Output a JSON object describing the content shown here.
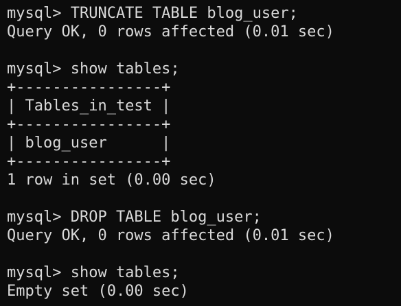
{
  "terminal": {
    "foreground": "#d9d9d9",
    "background": "#0c0c0c",
    "lines": [
      "mysql> TRUNCATE TABLE blog_user;",
      "Query OK, 0 rows affected (0.01 sec)",
      "",
      "mysql> show tables;",
      "+----------------+",
      "| Tables_in_test |",
      "+----------------+",
      "| blog_user      |",
      "+----------------+",
      "1 row in set (0.00 sec)",
      "",
      "mysql> DROP TABLE blog_user;",
      "Query OK, 0 rows affected (0.01 sec)",
      "",
      "mysql> show tables;",
      "Empty set (0.00 sec)"
    ]
  }
}
